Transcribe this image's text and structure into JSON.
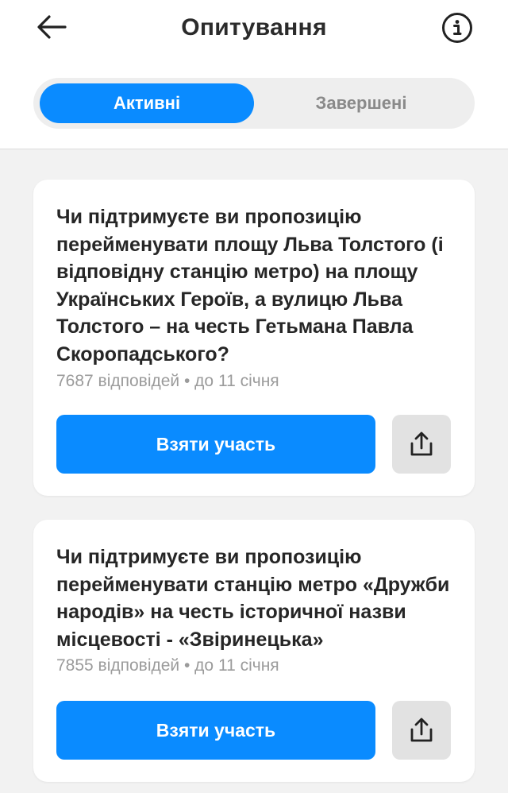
{
  "header": {
    "title": "Опитування",
    "back_icon": "arrow-left-icon",
    "info_icon": "info-icon"
  },
  "tabs": [
    {
      "label": "Активні",
      "active": true
    },
    {
      "label": "Завершені",
      "active": false
    }
  ],
  "polls": [
    {
      "question": "Чи підтримуєте ви пропозицію перейменувати площу Льва Толстого (і відповідну станцію метро) на площу Українських Героїв, а вулицю Льва Толстого – на честь Гетьмана Павла Скоропадського?",
      "meta": "7687 відповідей • до 11 січня",
      "button_label": "Взяти участь",
      "share_icon": "share-icon"
    },
    {
      "question": "Чи підтримуєте ви пропозицію перейменувати станцію метро «Дружби народів» на честь історичної назви місцевості - «Звіринецька»",
      "meta": "7855 відповідей • до 11 січня",
      "button_label": "Взяти участь",
      "share_icon": "share-icon"
    }
  ],
  "colors": {
    "accent": "#0a8bff",
    "background": "#f2f2f2",
    "card": "#ffffff",
    "meta_text": "#9b9b9b",
    "share_bg": "#e2e2e2"
  }
}
